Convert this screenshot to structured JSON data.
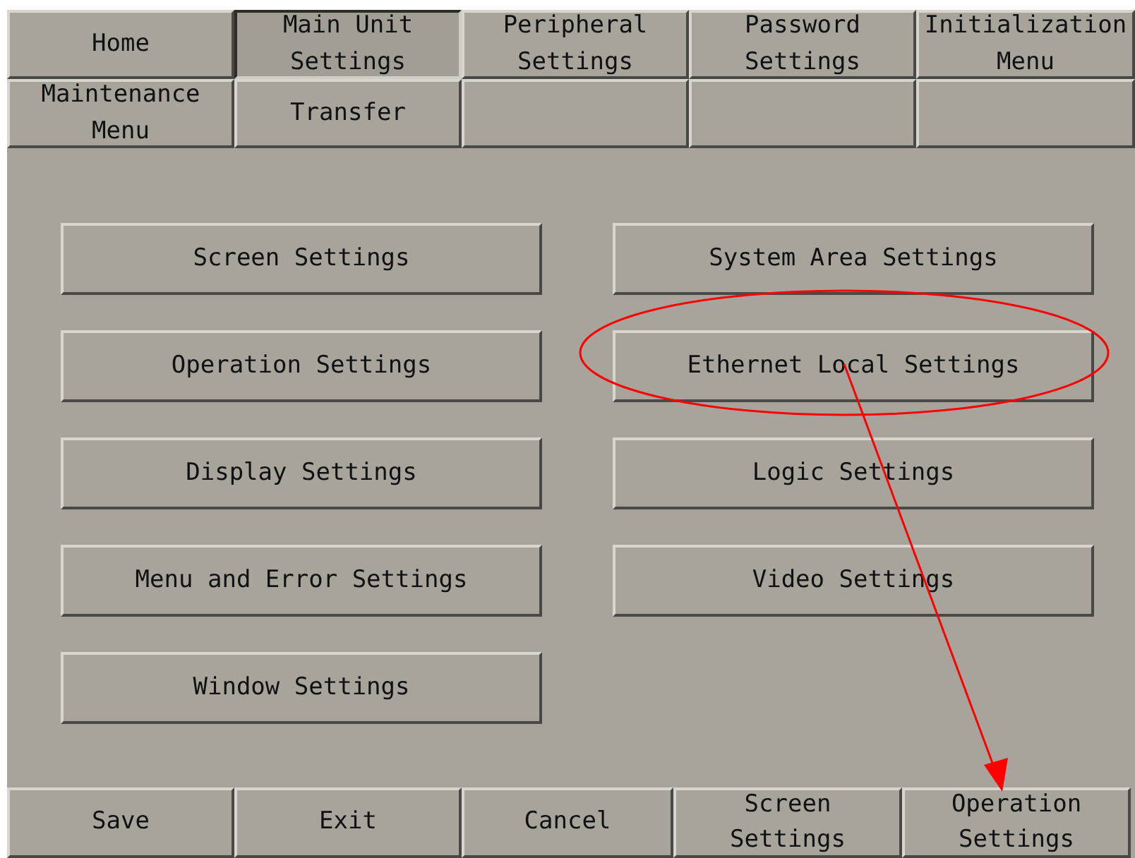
{
  "tabs": [
    {
      "label": "Home",
      "selected": false
    },
    {
      "label": "Main Unit\nSettings",
      "selected": true
    },
    {
      "label": "Peripheral\nSettings",
      "selected": false
    },
    {
      "label": "Password\nSettings",
      "selected": false
    },
    {
      "label": "Initialization\nMenu",
      "selected": false
    },
    {
      "label": "Maintenance\nMenu",
      "selected": false
    },
    {
      "label": "Transfer",
      "selected": false
    },
    {
      "selected": false
    },
    {
      "selected": false
    },
    {
      "selected": false
    }
  ],
  "settings_buttons": {
    "left": [
      "Screen Settings",
      "Operation Settings",
      "Display Settings",
      "Menu and Error Settings",
      "Window Settings"
    ],
    "right": [
      "System Area Settings",
      "Ethernet Local Settings",
      "Logic Settings",
      "Video Settings"
    ]
  },
  "bottom_buttons": [
    "Save",
    "Exit",
    "Cancel",
    "Screen\nSettings",
    "Operation\nSettings"
  ],
  "highlight_ellipse": {
    "color": "#ff0000"
  },
  "arrow": {
    "color": "#ff0000"
  }
}
